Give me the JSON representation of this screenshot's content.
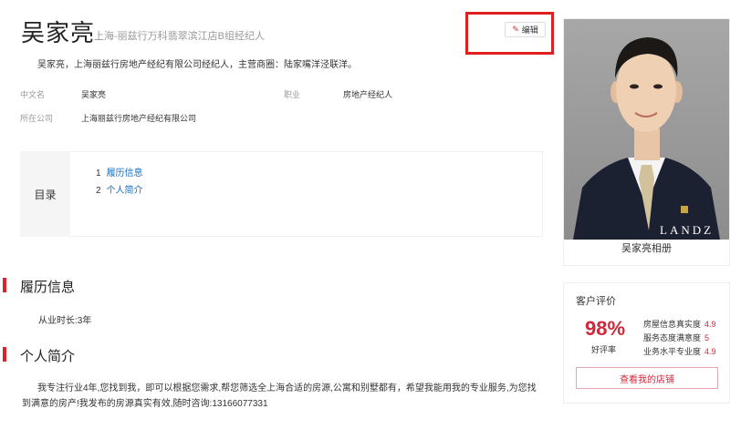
{
  "profile": {
    "name": "吴家亮",
    "subtitle": "上海-丽兹行万科翡翠滨江店B组经纪人",
    "summary": "吴家亮，上海丽兹行房地产经纪有限公司经纪人，主营商圈：陆家嘴洋泾联洋。",
    "edit_label": "编辑"
  },
  "info": {
    "cn_name_label": "中文名",
    "cn_name_value": "吴家亮",
    "job_label": "职业",
    "job_value": "房地产经纪人",
    "company_label": "所在公司",
    "company_value": "上海丽兹行房地产经纪有限公司"
  },
  "toc": {
    "title": "目录",
    "items": [
      {
        "num": "1",
        "label": "履历信息"
      },
      {
        "num": "2",
        "label": "个人简介"
      }
    ]
  },
  "sections": {
    "resume_title": "履历信息",
    "years": "从业时长:3年",
    "intro_title": "个人简介",
    "bio": "我专注行业4年,您找到我，即可以根据您需求,帮您筛选全上海合适的房源,公寓和别墅都有，希望我能用我的专业服务,为您找到满意的房产!我发布的房源真实有效,随时咨询:13166077331"
  },
  "album": {
    "watermark": "LANDZ",
    "label": "吴家亮相册"
  },
  "rating": {
    "title": "客户评价",
    "percent": "98%",
    "percent_label": "好评率",
    "metrics": [
      {
        "label": "房屋信息真实度",
        "value": "4.9"
      },
      {
        "label": "服务态度满意度",
        "value": "5"
      },
      {
        "label": "业务水平专业度",
        "value": "4.9"
      }
    ],
    "shop_button": "查看我的店铺"
  },
  "colors": {
    "accent_red": "#d0283a",
    "link_blue": "#136ec2",
    "highlight_border": "#e02020"
  }
}
